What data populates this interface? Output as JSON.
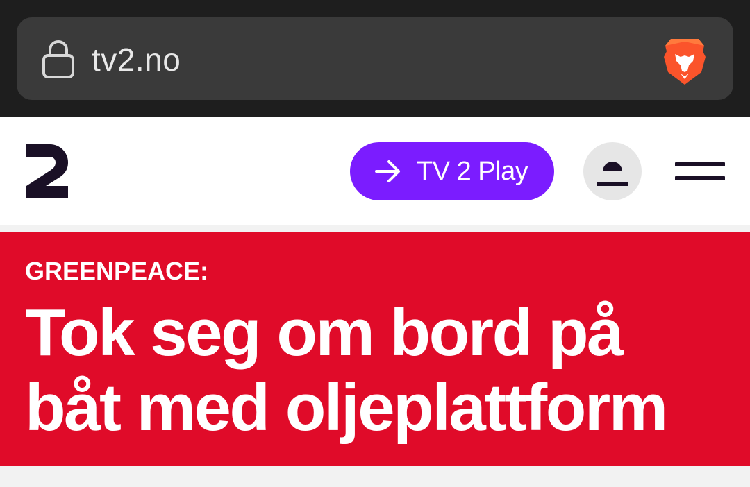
{
  "browser": {
    "url": "tv2.no",
    "lock_icon": "lock-icon",
    "shield_icon": "brave-lion-icon",
    "shield_color": "#fb542b"
  },
  "header": {
    "logo_icon": "tv2-logo-icon",
    "play_button": {
      "label": "TV 2 Play",
      "icon": "arrow-right-icon",
      "color": "#7b1cff"
    },
    "profile_icon": "user-profile-icon",
    "menu_icon": "hamburger-menu-icon"
  },
  "article": {
    "kicker": "GREENPEACE:",
    "headline": "Tok seg om bord på båt med oljeplattform",
    "background_color": "#e00b29"
  }
}
